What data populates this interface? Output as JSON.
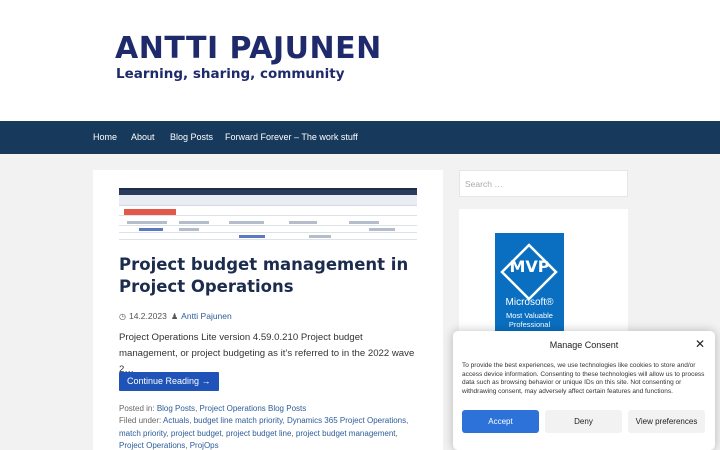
{
  "header": {
    "title": "ANTTI PAJUNEN",
    "tagline": "Learning, sharing, community"
  },
  "nav": {
    "items": [
      {
        "label": "Home"
      },
      {
        "label": "About"
      },
      {
        "label": "Blog Posts"
      },
      {
        "label": "Forward Forever – The work stuff"
      }
    ]
  },
  "post": {
    "title": "Project budget management in Project Operations",
    "date": "14.2.2023",
    "author": "Antti Pajunen",
    "excerpt": "Project Operations Lite version 4.59.0.210 Project budget management, or project budgeting as it’s referred to in the 2022 wave 2…",
    "cta_label": "Continue Reading →",
    "posted_in_label": "Posted in:",
    "posted_in": [
      "Blog Posts",
      "Project Operations Blog Posts"
    ],
    "filed_under_label": "Filed under:",
    "filed_under": [
      "Actuals",
      "budget line match priority",
      "Dynamics 365 Project Operations",
      "match priority",
      "project budget",
      "project budget line",
      "project budget management",
      "Project Operations",
      "ProjOps"
    ]
  },
  "sidebar": {
    "search_placeholder": "Search …",
    "badge": {
      "mvp": "MVP",
      "company": "Microsoft®",
      "subtitle": "Most Valuable Professional"
    }
  },
  "consent": {
    "title": "Manage Consent",
    "text": "To provide the best experiences, we use technologies like cookies to store and/or access device information. Consenting to these technologies will allow us to process data such as browsing behavior or unique IDs on this site. Not consenting or withdrawing consent, may adversely affect certain features and functions.",
    "accept_label": "Accept",
    "deny_label": "Deny",
    "prefs_label": "View preferences"
  },
  "colors": {
    "brand": "#1e2a6b",
    "nav_bg": "#17395c",
    "button": "#2053b8",
    "accept": "#2d72d9",
    "mvp_blue": "#0a6fc1"
  }
}
